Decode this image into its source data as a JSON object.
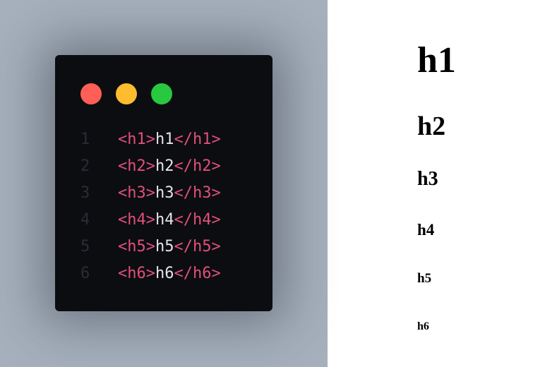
{
  "colors": {
    "page_background": "#a5b0bc",
    "editor_background": "#0c0d10",
    "dot_red": "#ff5f57",
    "dot_yellow": "#febc2e",
    "dot_green": "#28c840",
    "tag": "#e0507a",
    "content": "#e2e4e8",
    "line_number": "#2a2d34"
  },
  "editor": {
    "lines": [
      {
        "number": "1",
        "open": "<h1>",
        "content": "h1",
        "close": "</h1>"
      },
      {
        "number": "2",
        "open": "<h2>",
        "content": "h2",
        "close": "</h2>"
      },
      {
        "number": "3",
        "open": "<h3>",
        "content": "h3",
        "close": "</h3>"
      },
      {
        "number": "4",
        "open": "<h4>",
        "content": "h4",
        "close": "</h4>"
      },
      {
        "number": "5",
        "open": "<h5>",
        "content": "h5",
        "close": "</h5>"
      },
      {
        "number": "6",
        "open": "<h6>",
        "content": "h6",
        "close": "</h6>"
      }
    ]
  },
  "preview": {
    "h1": "h1",
    "h2": "h2",
    "h3": "h3",
    "h4": "h4",
    "h5": "h5",
    "h6": "h6"
  }
}
